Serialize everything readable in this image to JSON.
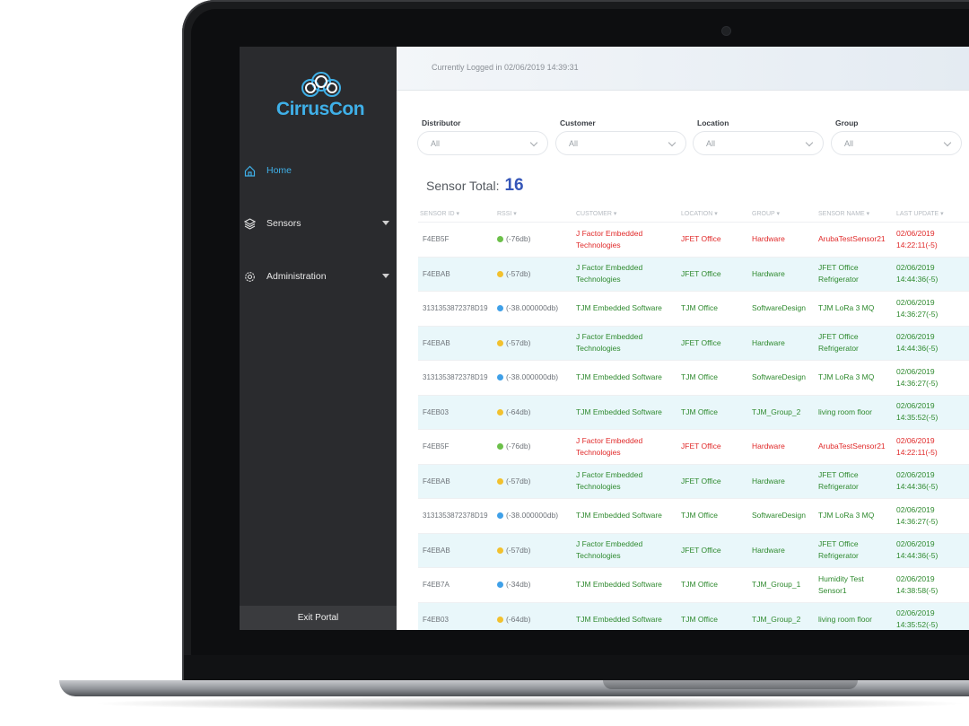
{
  "app": {
    "name": "CirrusCon"
  },
  "header": {
    "logged_in": "Currently Logged in 02/06/2019 14:39:31"
  },
  "sidebar": {
    "items": [
      {
        "label": "Home",
        "icon": "home-icon",
        "active": true
      },
      {
        "label": "Sensors",
        "icon": "layers-icon",
        "expandable": true
      },
      {
        "label": "Administration",
        "icon": "gear-icon",
        "expandable": true
      }
    ],
    "exit_label": "Exit Portal"
  },
  "filters": [
    {
      "label": "Distributor",
      "value": "All"
    },
    {
      "label": "Customer",
      "value": "All"
    },
    {
      "label": "Location",
      "value": "All"
    },
    {
      "label": "Group",
      "value": "All"
    }
  ],
  "summary": {
    "label": "Sensor Total:",
    "count": "16"
  },
  "table": {
    "columns": [
      "SENSOR ID ▾",
      "RSSI ▾",
      "CUSTOMER ▾",
      "LOCATION ▾",
      "GROUP ▾",
      "SENSOR NAME ▾",
      "LAST UPDATE ▾"
    ],
    "rows": [
      {
        "id": "F4EB5F",
        "rssi": "(-76db)",
        "rssi_color": "#6cc04a",
        "customer": "J Factor Embedded Technologies",
        "location": "JFET Office",
        "group": "Hardware",
        "name": "ArubaTestSensor21",
        "updated": "02/06/2019 14:22:11(-5)",
        "status": "warn"
      },
      {
        "id": "F4EBAB",
        "rssi": "(-57db)",
        "rssi_color": "#f2c12e",
        "customer": "J Factor Embedded Technologies",
        "location": "JFET Office",
        "group": "Hardware",
        "name": "JFET Office Refrigerator",
        "updated": "02/06/2019 14:44:36(-5)",
        "status": "ok"
      },
      {
        "id": "3131353872378D19",
        "rssi": "(-38.000000db)",
        "rssi_color": "#3fa0e8",
        "customer": "TJM Embedded Software",
        "location": "TJM Office",
        "group": "SoftwareDesign",
        "name": "TJM LoRa 3 MQ",
        "updated": "02/06/2019 14:36:27(-5)",
        "status": "ok"
      },
      {
        "id": "F4EBAB",
        "rssi": "(-57db)",
        "rssi_color": "#f2c12e",
        "customer": "J Factor Embedded Technologies",
        "location": "JFET Office",
        "group": "Hardware",
        "name": "JFET Office Refrigerator",
        "updated": "02/06/2019 14:44:36(-5)",
        "status": "ok"
      },
      {
        "id": "3131353872378D19",
        "rssi": "(-38.000000db)",
        "rssi_color": "#3fa0e8",
        "customer": "TJM Embedded Software",
        "location": "TJM Office",
        "group": "SoftwareDesign",
        "name": "TJM LoRa 3 MQ",
        "updated": "02/06/2019 14:36:27(-5)",
        "status": "ok"
      },
      {
        "id": "F4EB03",
        "rssi": "(-64db)",
        "rssi_color": "#f2c12e",
        "customer": "TJM Embedded Software",
        "location": "TJM Office",
        "group": "TJM_Group_2",
        "name": "living room floor",
        "updated": "02/06/2019 14:35:52(-5)",
        "status": "ok"
      },
      {
        "id": "F4EB5F",
        "rssi": "(-76db)",
        "rssi_color": "#6cc04a",
        "customer": "J Factor Embedded Technologies",
        "location": "JFET Office",
        "group": "Hardware",
        "name": "ArubaTestSensor21",
        "updated": "02/06/2019 14:22:11(-5)",
        "status": "warn"
      },
      {
        "id": "F4EBAB",
        "rssi": "(-57db)",
        "rssi_color": "#f2c12e",
        "customer": "J Factor Embedded Technologies",
        "location": "JFET Office",
        "group": "Hardware",
        "name": "JFET Office Refrigerator",
        "updated": "02/06/2019 14:44:36(-5)",
        "status": "ok"
      },
      {
        "id": "3131353872378D19",
        "rssi": "(-38.000000db)",
        "rssi_color": "#3fa0e8",
        "customer": "TJM Embedded Software",
        "location": "TJM Office",
        "group": "SoftwareDesign",
        "name": "TJM LoRa 3 MQ",
        "updated": "02/06/2019 14:36:27(-5)",
        "status": "ok"
      },
      {
        "id": "F4EBAB",
        "rssi": "(-57db)",
        "rssi_color": "#f2c12e",
        "customer": "J Factor Embedded Technologies",
        "location": "JFET Office",
        "group": "Hardware",
        "name": "JFET Office Refrigerator",
        "updated": "02/06/2019 14:44:36(-5)",
        "status": "ok"
      },
      {
        "id": "F4EB7A",
        "rssi": "(-34db)",
        "rssi_color": "#3fa0e8",
        "customer": "TJM Embedded Software",
        "location": "TJM Office",
        "group": "TJM_Group_1",
        "name": "Humidity Test Sensor1",
        "updated": "02/06/2019 14:38:58(-5)",
        "status": "ok"
      },
      {
        "id": "F4EB03",
        "rssi": "(-64db)",
        "rssi_color": "#f2c12e",
        "customer": "TJM Embedded Software",
        "location": "TJM Office",
        "group": "TJM_Group_2",
        "name": "living room floor",
        "updated": "02/06/2019 14:35:52(-5)",
        "status": "ok"
      }
    ]
  },
  "colors": {
    "accent": "#3fb0e8",
    "ok_text": "#2f8a2f",
    "warn_text": "#e02a2a",
    "row_alt": "#e9f7fa",
    "sidebar": "#2a2b2e"
  }
}
